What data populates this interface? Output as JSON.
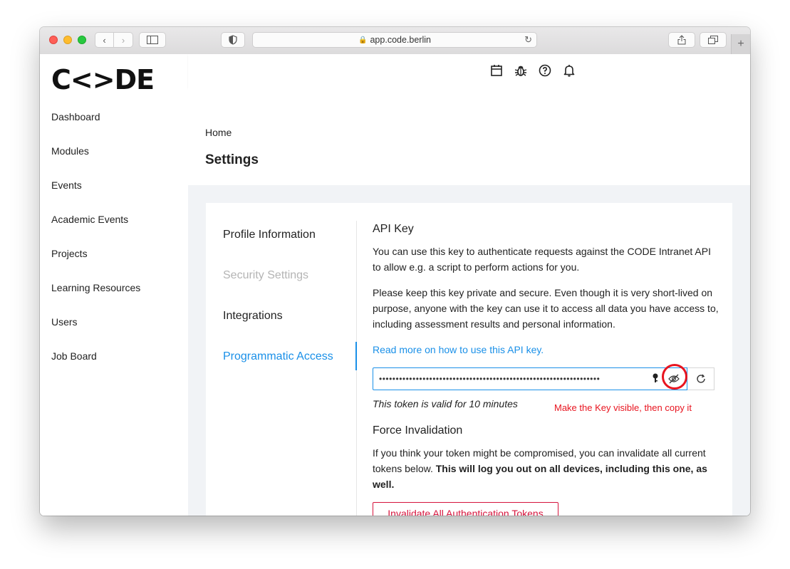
{
  "browser": {
    "url": "app.code.berlin",
    "plus_label": "+"
  },
  "app": {
    "logo_text": "C<>DE"
  },
  "sidebar": {
    "items": [
      {
        "label": "Dashboard"
      },
      {
        "label": "Modules"
      },
      {
        "label": "Events"
      },
      {
        "label": "Academic Events"
      },
      {
        "label": "Projects"
      },
      {
        "label": "Learning Resources"
      },
      {
        "label": "Users"
      },
      {
        "label": "Job Board"
      }
    ]
  },
  "header": {
    "breadcrumb": "Home",
    "title": "Settings"
  },
  "settings_tabs": [
    {
      "label": "Profile Information",
      "state": "normal"
    },
    {
      "label": "Security Settings",
      "state": "disabled"
    },
    {
      "label": "Integrations",
      "state": "normal"
    },
    {
      "label": "Programmatic Access",
      "state": "active"
    }
  ],
  "api_key": {
    "heading": "API Key",
    "intro": "You can use this key to authenticate requests against the CODE Intranet API to allow e.g. a script to perform actions for you.",
    "warning": "Please keep this key private and secure. Even though it is very short-lived on purpose, anyone with the key can use it to access all data you have access to, including assessment results and personal information.",
    "read_more_link": "Read more on how to use this API key.",
    "masked_value": "••••••••••••••••••••••••••••••••••••••••••••••••••••••••••••••••••",
    "validity": "This token is valid for 10 minutes",
    "annotation": "Make the Key visible, then copy it"
  },
  "force_invalidation": {
    "heading": "Force Invalidation",
    "text_plain": "If you think your token might be compromised, you can invalidate all current tokens below. ",
    "text_bold": "This will log you out on all devices, including this one, as well.",
    "button_label": "Invalidate All Authentication Tokens"
  },
  "colors": {
    "accent": "#1a90e8",
    "danger": "#d6133c",
    "annotation_red": "#e8141f"
  }
}
